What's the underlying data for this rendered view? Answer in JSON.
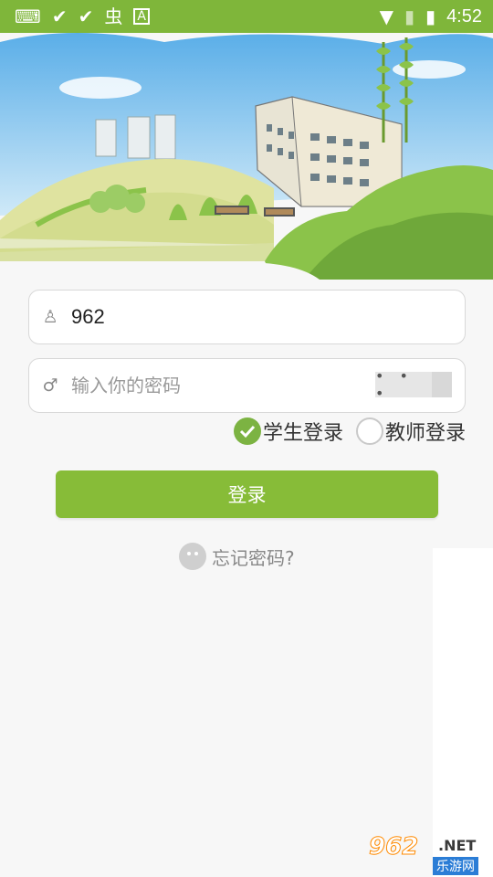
{
  "status_bar": {
    "time": "4:52",
    "icons_left": [
      "keyboard-icon",
      "check-download-icon",
      "check-download-icon",
      "bug-icon",
      "font-a-icon"
    ],
    "icons_right": [
      "wifi-icon",
      "no-sim-icon",
      "battery-charging-icon"
    ]
  },
  "login": {
    "username": {
      "value": "962",
      "icon": "user-icon"
    },
    "password": {
      "value": "",
      "placeholder": "输入你的密码",
      "icon": "key-icon",
      "toggle_label": "• • •"
    },
    "roles": [
      {
        "label": "学生登录",
        "checked": true
      },
      {
        "label": "教师登录",
        "checked": false
      }
    ],
    "submit_label": "登录",
    "forgot_label": "忘记密码?"
  },
  "watermark": {
    "logo": "962",
    "suffix": ".NET",
    "sub": "乐游网"
  },
  "colors": {
    "accent": "#87bc38",
    "status_bar": "#7fb63a",
    "background": "#f7f7f7"
  }
}
